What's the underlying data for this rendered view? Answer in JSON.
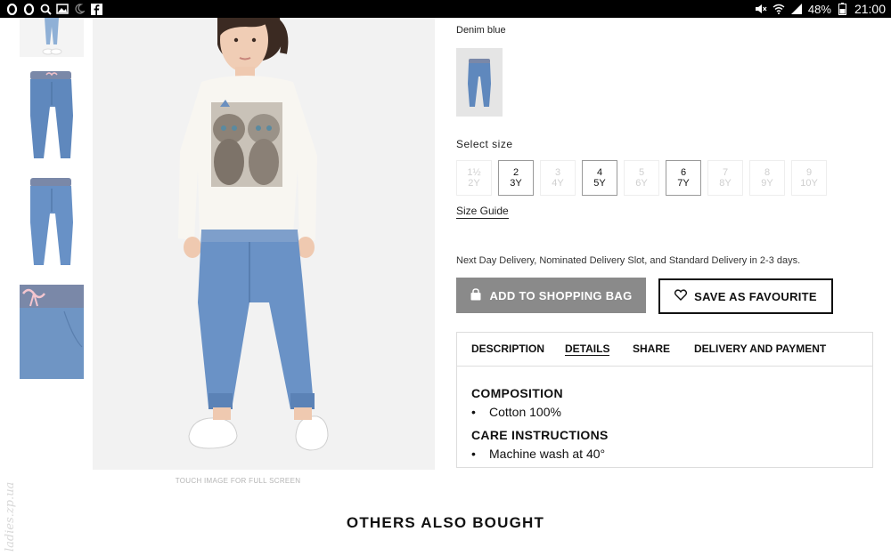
{
  "status_bar": {
    "left_icons": [
      "circle-icon",
      "circle-icon",
      "search-icon",
      "image-icon",
      "moon-icon",
      "facebook-icon"
    ],
    "right_icons": [
      "mute-icon",
      "wifi-icon",
      "signal-icon",
      "battery-icon"
    ],
    "battery": "48%",
    "time": "21:00"
  },
  "product": {
    "color_name": "Denim blue",
    "touch_hint": "TOUCH IMAGE FOR FULL SCREEN",
    "select_size_label": "Select size",
    "sizes": [
      {
        "line1": "1½",
        "line2": "2Y",
        "available": false
      },
      {
        "line1": "2",
        "line2": "3Y",
        "available": true
      },
      {
        "line1": "3",
        "line2": "4Y",
        "available": false
      },
      {
        "line1": "4",
        "line2": "5Y",
        "available": true
      },
      {
        "line1": "5",
        "line2": "6Y",
        "available": false
      },
      {
        "line1": "6",
        "line2": "7Y",
        "available": true
      },
      {
        "line1": "7",
        "line2": "8Y",
        "available": false
      },
      {
        "line1": "8",
        "line2": "9Y",
        "available": false
      },
      {
        "line1": "9",
        "line2": "10Y",
        "available": false
      }
    ],
    "size_guide": "Size Guide",
    "delivery_note": "Next Day Delivery, Nominated Delivery Slot, and Standard Delivery in 2-3 days.",
    "add_to_bag": "ADD TO SHOPPING BAG",
    "save_favourite": "SAVE AS FAVOURITE",
    "tabs": [
      {
        "label": "DESCRIPTION",
        "active": false
      },
      {
        "label": "DETAILS",
        "active": true
      },
      {
        "label": "SHARE",
        "active": false
      },
      {
        "label": "DELIVERY AND PAYMENT",
        "active": false
      }
    ],
    "details": {
      "composition_title": "COMPOSITION",
      "composition_items": [
        "Cotton 100%"
      ],
      "care_title": "CARE INSTRUCTIONS",
      "care_items": [
        "Machine wash at 40°"
      ]
    }
  },
  "others_title": "OTHERS ALSO BOUGHT",
  "watermark": "ladies.zp.ua",
  "colors": {
    "bag_button": "#8a8a8a",
    "denim": "#6f95c4",
    "waistband": "#7a88a8"
  }
}
